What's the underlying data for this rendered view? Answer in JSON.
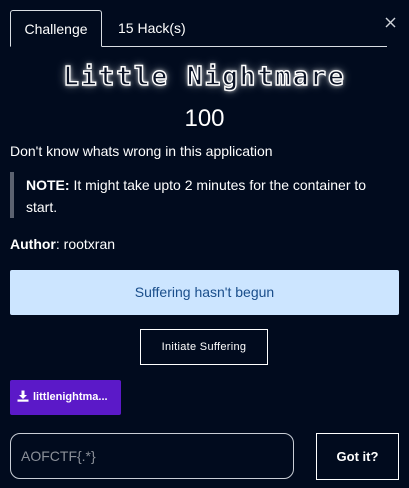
{
  "tabs": [
    {
      "label": "Challenge",
      "active": true
    },
    {
      "label": "15 Hack(s)",
      "active": false
    }
  ],
  "close": {
    "icon": "close-icon",
    "glyph": "×"
  },
  "challenge": {
    "name": "Little Nightmare",
    "value": "100",
    "description": "Don't know whats wrong in this application",
    "note_label": "NOTE:",
    "note_text": "It might take upto 2 minutes for the container to start.",
    "author_label": "Author",
    "author_sep": ":",
    "author_name": "rootxran"
  },
  "status": {
    "text": "Suffering hasn't begun"
  },
  "actions": {
    "initiate_label": "Initiate Suffering",
    "download_label": "littlenightma...",
    "download_icon": "download-icon"
  },
  "submission": {
    "placeholder": "AOFCTF{.*}",
    "value": "",
    "submit_label": "Got it?"
  },
  "colors": {
    "background": "#010b1e",
    "status_bg": "#cce5ff",
    "status_text": "#1a4e8b",
    "download_bg": "#5b19c8"
  }
}
